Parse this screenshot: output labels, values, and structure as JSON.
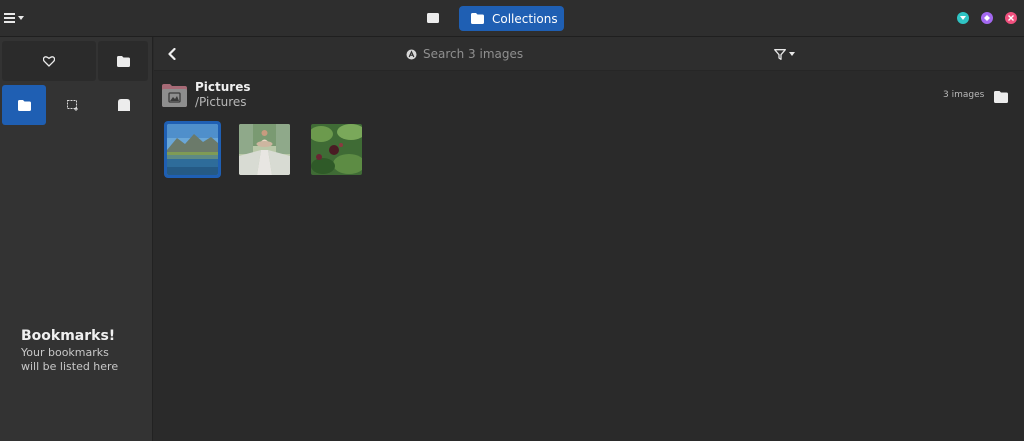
{
  "header": {
    "collections_label": "Collections"
  },
  "sidebar": {
    "bookmarks_title": "Bookmarks!",
    "bookmarks_line1": "Your bookmarks",
    "bookmarks_line2": "will be listed here"
  },
  "toolbar": {
    "search_placeholder": "Search 3 images"
  },
  "folder": {
    "name": "Pictures",
    "path": "/Pictures",
    "count": "3 images"
  },
  "thumbnails": [
    {
      "name": "mountain-lake",
      "selected": true
    },
    {
      "name": "person-meditating",
      "selected": false
    },
    {
      "name": "berries-plant",
      "selected": false
    }
  ],
  "colors": {
    "accent": "#1f5fb3",
    "minimize": "#2fc4c4",
    "maximize": "#a368f0",
    "close": "#f0507e"
  }
}
